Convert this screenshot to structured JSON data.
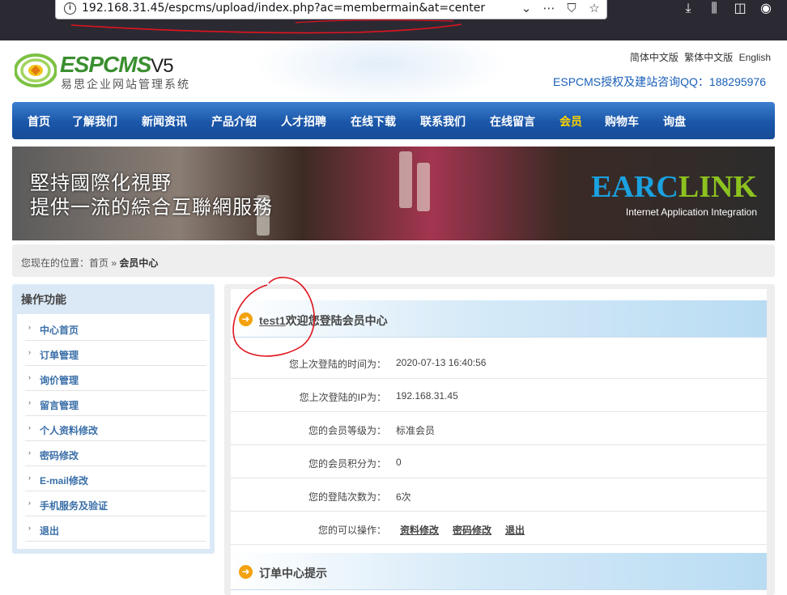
{
  "browser": {
    "url": "192.168.31.45/espcms/upload/index.php?ac=membermain&at=center"
  },
  "header": {
    "logo_main": "ESPCMS",
    "logo_version": "V5",
    "logo_sub": "易思企业网站管理系统",
    "lang_simplified": "简体中文版",
    "lang_traditional": "繁体中文版",
    "lang_english": "English",
    "hotline": "ESPCMS授权及建站咨询QQ：188295976"
  },
  "nav": {
    "items": [
      "首页",
      "了解我们",
      "新闻资讯",
      "产品介绍",
      "人才招聘",
      "在线下载",
      "联系我们",
      "在线留言",
      "会员",
      "购物车",
      "询盘"
    ],
    "active_index": 8
  },
  "banner": {
    "slogan_line1": "堅持國際化視野",
    "slogan_line2": "提供一流的綜合互聯網服務",
    "brand_part1": "EARC",
    "brand_part2": "LINK",
    "tagline": "Internet Application Integration"
  },
  "breadcrumb": {
    "prefix": "您现在的位置：首页 » ",
    "current": "会员中心"
  },
  "sidebar": {
    "title": "操作功能",
    "items": [
      "中心首页",
      "订单管理",
      "询价管理",
      "留言管理",
      "个人资料修改",
      "密码修改",
      "E-mail修改",
      "手机服务及验证",
      "退出"
    ]
  },
  "main": {
    "welcome_user": "test1",
    "welcome_text": "欢迎您登陆会员中心",
    "rows": [
      {
        "label": "您上次登陆的时间为：",
        "value": "2020-07-13 16:40:56"
      },
      {
        "label": "您上次登陆的IP为：",
        "value": "192.168.31.45"
      },
      {
        "label": "您的会员等级为：",
        "value": "标准会员"
      },
      {
        "label": "您的会员积分为：",
        "value": "0"
      },
      {
        "label": "您的登陆次数为：",
        "value": "6次"
      }
    ],
    "actions_label": "您的可以操作：",
    "actions": [
      "资料修改",
      "密码修改",
      "退出"
    ],
    "order_title": "订单中心提示"
  },
  "colors": {
    "nav_bg": "#1a56a8",
    "nav_active": "#ffd400",
    "annotation": "#e0141e",
    "sidebar_link": "#3a6fa8"
  }
}
